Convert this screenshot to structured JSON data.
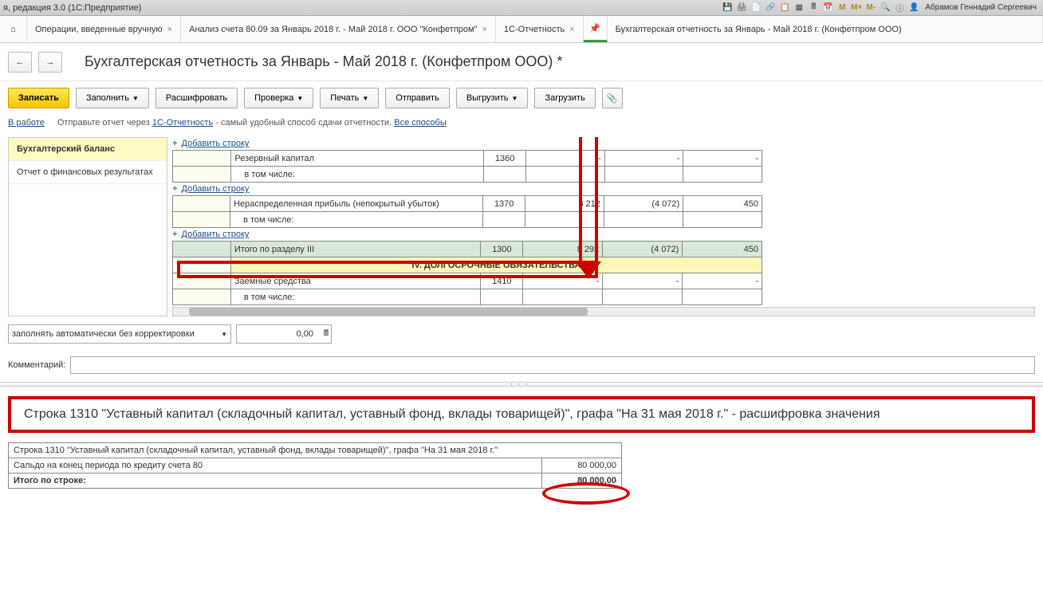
{
  "window": {
    "title": "я, редакция 3.0 (1С:Предприятие)",
    "user": "Абрамов Геннадий Сергеевич"
  },
  "tb": {
    "m": "M",
    "mplus": "M+",
    "mminus": "M-"
  },
  "tabs": {
    "t1": "Операции, введенные вручную",
    "t2": "Анализ счета 80.09 за Январь 2018 г. - Май 2018 г. ООО \"Конфетпром\"",
    "t3": "1С-Отчетность",
    "t4": "Бухгалтерская отчетность за Январь - Май 2018 г. (Конфетпром ООО)"
  },
  "page": {
    "title": "Бухгалтерская отчетность за Январь - Май 2018 г. (Конфетпром ООО) *"
  },
  "toolbar": {
    "save": "Записать",
    "fill": "Заполнить",
    "decrypt": "Расшифровать",
    "check": "Проверка",
    "print": "Печать",
    "send": "Отправить",
    "unload": "Выгрузить",
    "load": "Загрузить"
  },
  "hint": {
    "status": "В работе",
    "text_a": "Отправьте отчет через ",
    "link_a": "1С-Отчетность",
    "text_b": " - самый удобный способ сдачи отчетности. ",
    "link_b": "Все способы"
  },
  "leftnav": {
    "i1": "Бухгалтерский баланс",
    "i2": "Отчет о финансовых результатах"
  },
  "addrow": "Добавить строку",
  "table": {
    "r1": "Резервный капитал",
    "r1code": "1360",
    "sub": "в том числе:",
    "r2": "Нераспределенная прибыль (непокрытый убыток)",
    "r2code": "1370",
    "r2v1": "8 212",
    "r2v2": "(4 072)",
    "r2v3": "450",
    "total": "Итого по разделу III",
    "tcode": "1300",
    "tv1": "8 292",
    "tv2": "(4 072)",
    "tv3": "450",
    "sec": "IV. ДОЛГОСРОЧНЫЕ ОБЯЗАТЕЛЬСТВА",
    "r3": "Заемные средства",
    "r3code": "1410"
  },
  "lower": {
    "select": "заполнять автоматически без корректировки",
    "num": "0,00",
    "comment_lbl": "Комментарий:"
  },
  "heading": "Строка 1310 \"Уставный капитал (складочный капитал, уставный фонд, вклады товарищей)\", графа \"На 31 мая 2018 г.\" - расшифровка значения",
  "detail": {
    "r1": "Строка 1310 \"Уставный капитал (складочный капитал, уставный фонд, вклады товарищей)\", графа \"На 31 мая 2018 г.\"",
    "r2": "Сальдо на конец периода по кредиту счета 80",
    "r2v": "80 000,00",
    "r3": "Итого по строке:",
    "r3v": "80 000,00"
  }
}
